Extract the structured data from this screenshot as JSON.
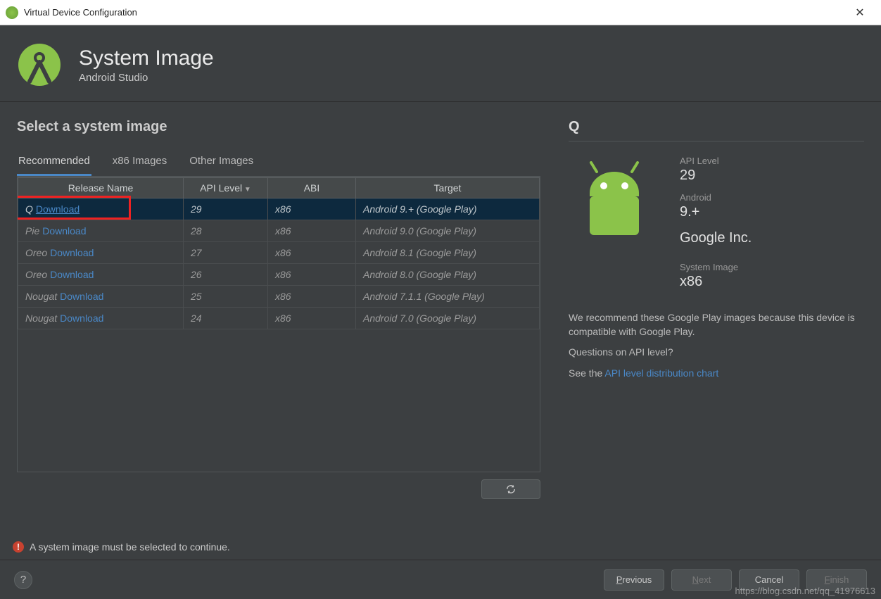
{
  "window": {
    "title": "Virtual Device Configuration"
  },
  "header": {
    "title": "System Image",
    "subtitle": "Android Studio"
  },
  "section_title": "Select a system image",
  "tabs": [
    {
      "label": "Recommended",
      "active": true
    },
    {
      "label": "x86 Images",
      "active": false
    },
    {
      "label": "Other Images",
      "active": false
    }
  ],
  "columns": {
    "release": "Release Name",
    "api": "API Level",
    "abi": "ABI",
    "target": "Target"
  },
  "rows": [
    {
      "name": "Q",
      "download": "Download",
      "api": "29",
      "abi": "x86",
      "target": "Android 9.+ (Google Play)",
      "selected": true
    },
    {
      "name": "Pie",
      "download": "Download",
      "api": "28",
      "abi": "x86",
      "target": "Android 9.0 (Google Play)",
      "selected": false
    },
    {
      "name": "Oreo",
      "download": "Download",
      "api": "27",
      "abi": "x86",
      "target": "Android 8.1 (Google Play)",
      "selected": false
    },
    {
      "name": "Oreo",
      "download": "Download",
      "api": "26",
      "abi": "x86",
      "target": "Android 8.0 (Google Play)",
      "selected": false
    },
    {
      "name": "Nougat",
      "download": "Download",
      "api": "25",
      "abi": "x86",
      "target": "Android 7.1.1 (Google Play)",
      "selected": false
    },
    {
      "name": "Nougat",
      "download": "Download",
      "api": "24",
      "abi": "x86",
      "target": "Android 7.0 (Google Play)",
      "selected": false
    }
  ],
  "details": {
    "title": "Q",
    "api_label": "API Level",
    "api_value": "29",
    "android_label": "Android",
    "android_value": "9.+",
    "vendor": "Google Inc.",
    "sysimg_label": "System Image",
    "sysimg_value": "x86",
    "recommend_text": "We recommend these Google Play images because this device is compatible with Google Play.",
    "question": "Questions on API level?",
    "see_prefix": "See the ",
    "see_link": "API level distribution chart"
  },
  "error": "A system image must be selected to continue.",
  "footer": {
    "previous": "Previous",
    "next": "Next",
    "cancel": "Cancel",
    "finish": "Finish"
  },
  "watermark": "https://blog.csdn.net/qq_41976613"
}
